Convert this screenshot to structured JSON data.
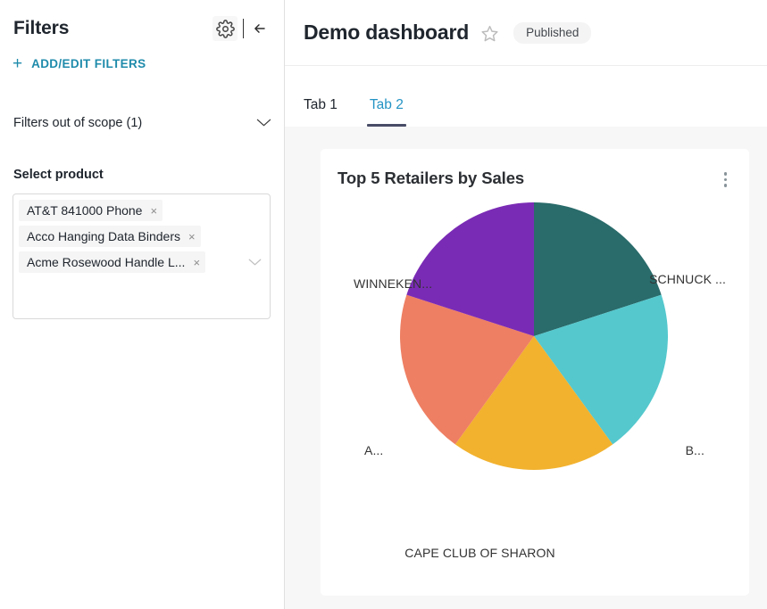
{
  "sidebar": {
    "title": "Filters",
    "gear_icon": "gear-icon",
    "collapse_icon": "collapse-left-icon",
    "add_edit_filters": {
      "plus": "+",
      "label": "ADD/EDIT FILTERS"
    },
    "out_of_scope": {
      "label": "Filters out of scope (1)",
      "chevron": "chevron-down-icon"
    },
    "filter_field": {
      "label": "Select product",
      "placeholder": "Select product",
      "dropdown_arrow": "chevron-down-icon",
      "tags": [
        {
          "label": "AT&T 841000 Phone",
          "remove": "×"
        },
        {
          "label": "Acco Hanging Data Binders",
          "remove": "×"
        },
        {
          "label": "Acme Rosewood Handle L...",
          "remove": "×"
        }
      ]
    }
  },
  "header": {
    "title": "Demo dashboard",
    "favorite_icon": "star-outline-icon",
    "status_badge": "Published"
  },
  "tabs": [
    {
      "label": "Tab 1",
      "active": false
    },
    {
      "label": "Tab 2",
      "active": true
    }
  ],
  "chart_card": {
    "title": "Top 5 Retailers by Sales",
    "menu_icon": "kebab-menu-icon"
  },
  "colors": {
    "accent_link": "#1f8bab",
    "tab_active_text": "#2393c4",
    "tab_active_indicator": "#484c66",
    "canvas_bg": "#f7f7f7",
    "card_bg": "#ffffff",
    "text_primary": "#20262e"
  },
  "chart_data": {
    "type": "pie",
    "title": "Top 5 Retailers by Sales",
    "labels": [
      "SCHNUCK ...",
      "B...",
      "CAPE CLUB OF SHARON",
      "A...",
      "WINNEKEN..."
    ],
    "values": [
      20,
      20,
      20,
      20,
      20
    ],
    "colors": [
      "#2a6b6b",
      "#54c8cd",
      "#f2b22e",
      "#ee7f63",
      "#7a2bb5"
    ],
    "legend": "none",
    "labels_position": "outside",
    "start_angle_deg": 0,
    "donut": false
  }
}
